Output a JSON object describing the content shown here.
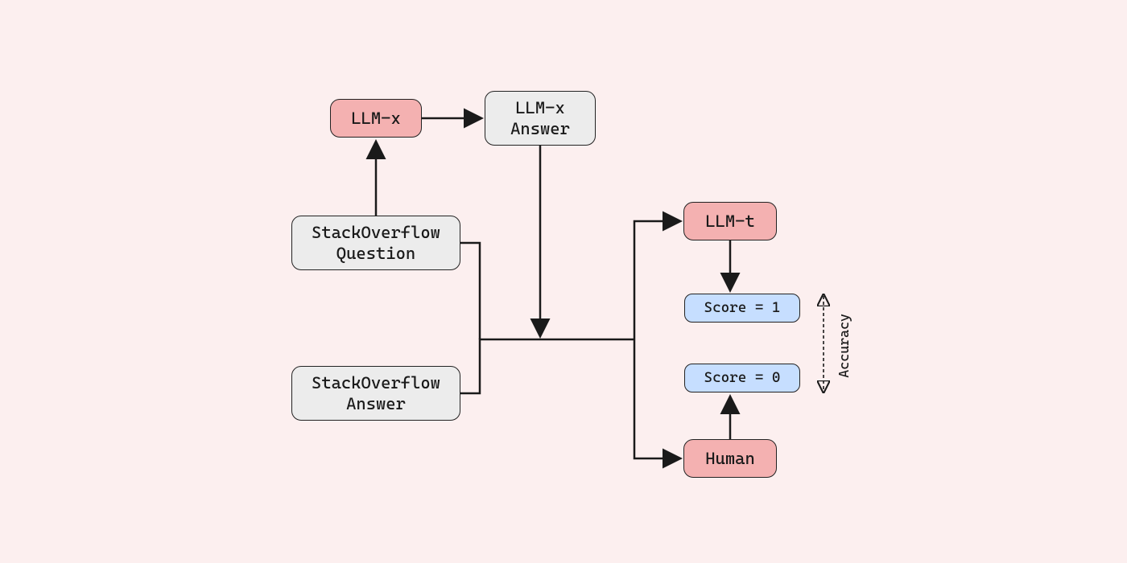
{
  "nodes": {
    "llmx": "LLM-x",
    "llmx_answer": "LLM-x\nAnswer",
    "so_question": "StackOverflow\nQuestion",
    "so_answer": "StackOverflow\nAnswer",
    "llmt": "LLM-t",
    "score1": "Score = 1",
    "score0": "Score = 0",
    "human": "Human"
  },
  "labels": {
    "accuracy": "Accuracy"
  }
}
